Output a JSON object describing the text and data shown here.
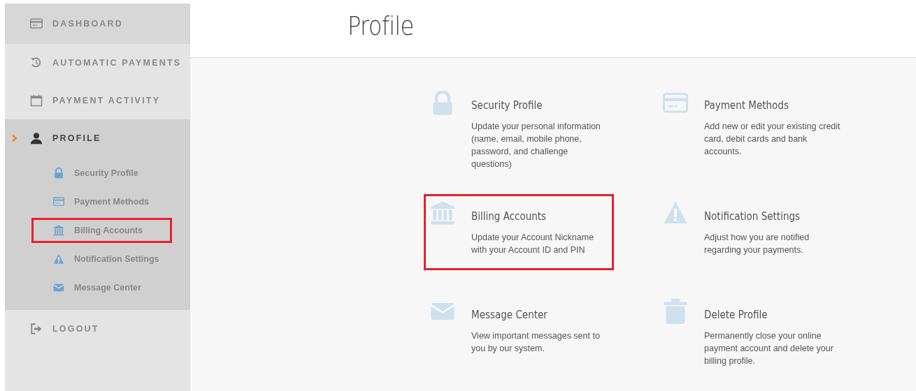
{
  "sidebar": {
    "items": [
      {
        "label": "DASHBOARD",
        "kind": "card",
        "selected": false
      },
      {
        "label": "AUTOMATIC PAYMENTS",
        "kind": "history",
        "selected": false
      },
      {
        "label": "PAYMENT ACTIVITY",
        "kind": "calendar",
        "selected": false
      },
      {
        "label": "PROFILE",
        "kind": "user",
        "selected": true,
        "children": [
          {
            "label": "Security Profile",
            "kind": "lock",
            "highlighted": false
          },
          {
            "label": "Payment Methods",
            "kind": "card",
            "highlighted": false
          },
          {
            "label": "Billing Accounts",
            "kind": "bank",
            "highlighted": true
          },
          {
            "label": "Notification Settings",
            "kind": "warning",
            "highlighted": false
          },
          {
            "label": "Message Center",
            "kind": "mail",
            "highlighted": false
          }
        ]
      },
      {
        "label": "LOGOUT",
        "kind": "logout",
        "selected": false
      }
    ]
  },
  "page": {
    "title": "Profile"
  },
  "cards": [
    {
      "title": "Security Profile",
      "kind": "lock",
      "highlighted": false,
      "description": "Update your personal information (name, email, mobile phone, password, and challenge questions)"
    },
    {
      "title": "Payment Methods",
      "kind": "card",
      "highlighted": false,
      "description": "Add new or edit your existing credit card, debit cards and bank accounts."
    },
    {
      "title": "Billing Accounts",
      "kind": "bank",
      "highlighted": true,
      "description": "Update your Account Nickname with your Account ID and PIN"
    },
    {
      "title": "Notification Settings",
      "kind": "warning",
      "highlighted": false,
      "description": "Adjust how you are notified regarding your payments."
    },
    {
      "title": "Message Center",
      "kind": "mail",
      "highlighted": false,
      "description": "View important messages sent to you by our system."
    },
    {
      "title": "Delete Profile",
      "kind": "trash",
      "highlighted": false,
      "description": "Permanently close your online payment account and delete your billing profile."
    }
  ]
}
